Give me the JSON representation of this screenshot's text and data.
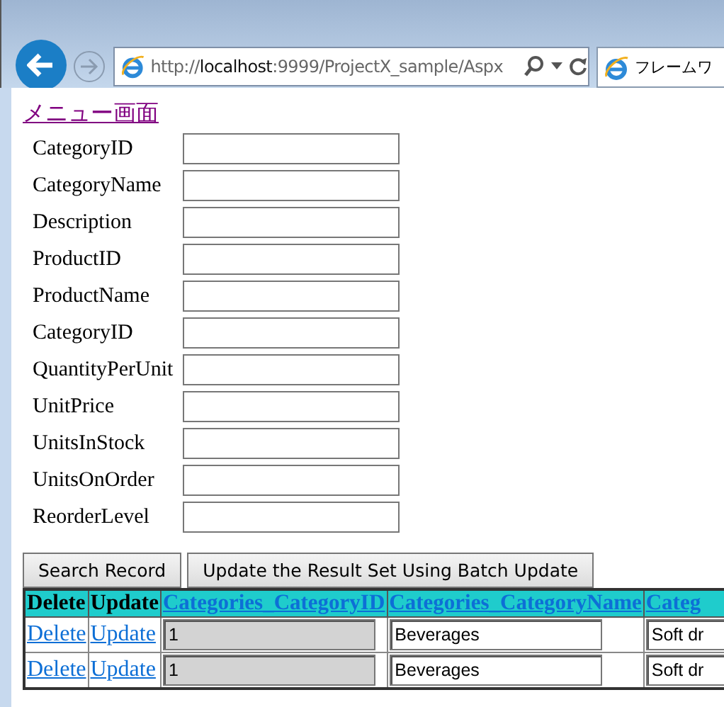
{
  "browser": {
    "address": {
      "prefix": "http://",
      "host": "localhost",
      "rest": ":9999/ProjectX_sample/Aspx"
    },
    "tab_title": "フレームワ"
  },
  "menu_link": "メニュー画面",
  "form_fields": [
    {
      "label": "CategoryID"
    },
    {
      "label": "CategoryName"
    },
    {
      "label": "Description"
    },
    {
      "label": "ProductID"
    },
    {
      "label": "ProductName"
    },
    {
      "label": "CategoryID"
    },
    {
      "label": "QuantityPerUnit"
    },
    {
      "label": "UnitPrice"
    },
    {
      "label": "UnitsInStock"
    },
    {
      "label": "UnitsOnOrder"
    },
    {
      "label": "ReorderLevel"
    }
  ],
  "buttons": [
    "Search Record",
    "Update the Result Set Using Batch Update"
  ],
  "table": {
    "columns": [
      {
        "label": "Delete",
        "kind": "plain"
      },
      {
        "label": "Update",
        "kind": "plain"
      },
      {
        "label": "Categories_CategoryID",
        "kind": "link"
      },
      {
        "label": "Categories_CategoryName",
        "kind": "link"
      },
      {
        "label": "Categ",
        "kind": "link"
      }
    ],
    "rows": [
      {
        "cells": [
          "Delete",
          "Update",
          "1",
          "Beverages",
          "Soft dr"
        ]
      },
      {
        "cells": [
          "Delete",
          "Update",
          "1",
          "Beverages",
          "Soft dr"
        ]
      }
    ]
  }
}
